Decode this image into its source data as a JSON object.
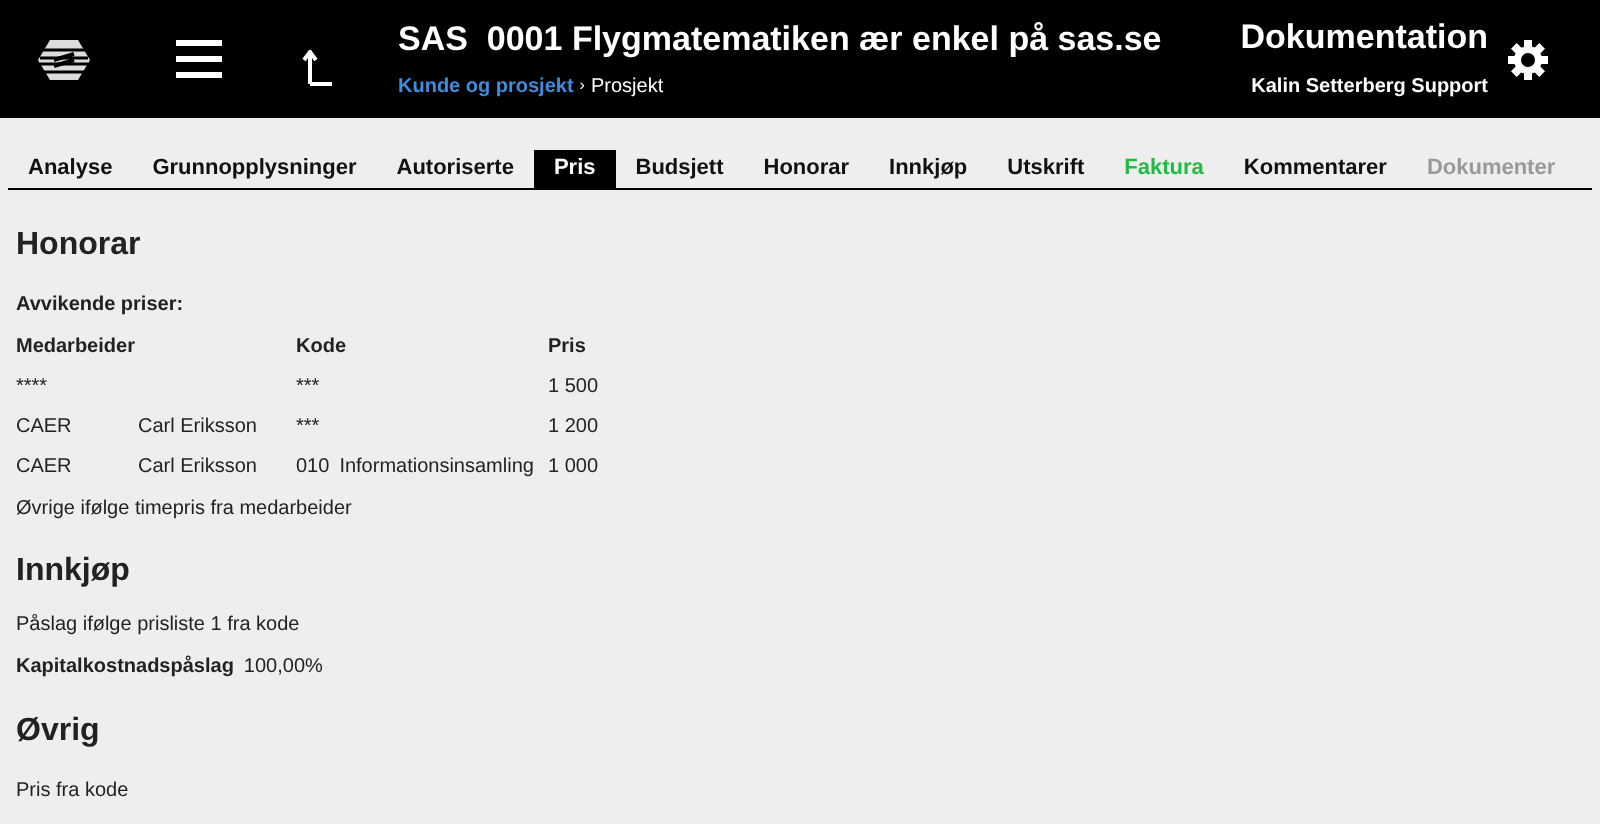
{
  "header": {
    "title": "SAS  0001 Flygmatematiken ær enkel på sas.se",
    "breadcrumb": [
      {
        "label": "Kunde og prosjekt",
        "link": true
      },
      {
        "label": "Prosjekt",
        "link": false
      }
    ],
    "separator": "›",
    "section": "Dokumentation",
    "user": "Kalin Setterberg Support"
  },
  "tabs": [
    {
      "label": "Analyse",
      "selected": false,
      "disabled": false
    },
    {
      "label": "Grunnopplysninger",
      "selected": false,
      "disabled": false
    },
    {
      "label": "Autoriserte",
      "selected": false,
      "disabled": false
    },
    {
      "label": "Pris",
      "selected": true,
      "disabled": false
    },
    {
      "label": "Budsjett",
      "selected": false,
      "disabled": false
    },
    {
      "label": "Honorar",
      "selected": false,
      "disabled": false
    },
    {
      "label": "Innkjøp",
      "selected": false,
      "disabled": false
    },
    {
      "label": "Utskrift",
      "selected": false,
      "disabled": false
    },
    {
      "label": "Faktura",
      "selected": false,
      "disabled": false,
      "color": "#22bb44"
    },
    {
      "label": "Kommentarer",
      "selected": false,
      "disabled": false
    },
    {
      "label": "Dokumenter",
      "selected": false,
      "disabled": true
    }
  ],
  "honorar": {
    "heading": "Honorar",
    "subheading": "Avvikende priser:",
    "columns": [
      "Medarbeider",
      "Kode",
      "Pris"
    ],
    "rows": [
      {
        "initials": "****",
        "code": "***",
        "price": "1 500"
      },
      {
        "initials": "CAER",
        "name": "Carl Eriksson",
        "code": "***",
        "price": "1 200"
      },
      {
        "initials": "CAER",
        "name": "Carl Eriksson",
        "code": "010",
        "code_name": "Informationsinsamling",
        "price": "1 000"
      }
    ],
    "note": "Øvrige ifølge timepris fra medarbeider"
  },
  "innkjop": {
    "heading": "Innkjøp",
    "note": "Påslag ifølge prisliste 1 fra kode",
    "field_label": "Kapitalkostnadspåslag",
    "field_value": "100,00%"
  },
  "ovrig": {
    "heading": "Øvrig",
    "note": "Pris fra kode"
  }
}
